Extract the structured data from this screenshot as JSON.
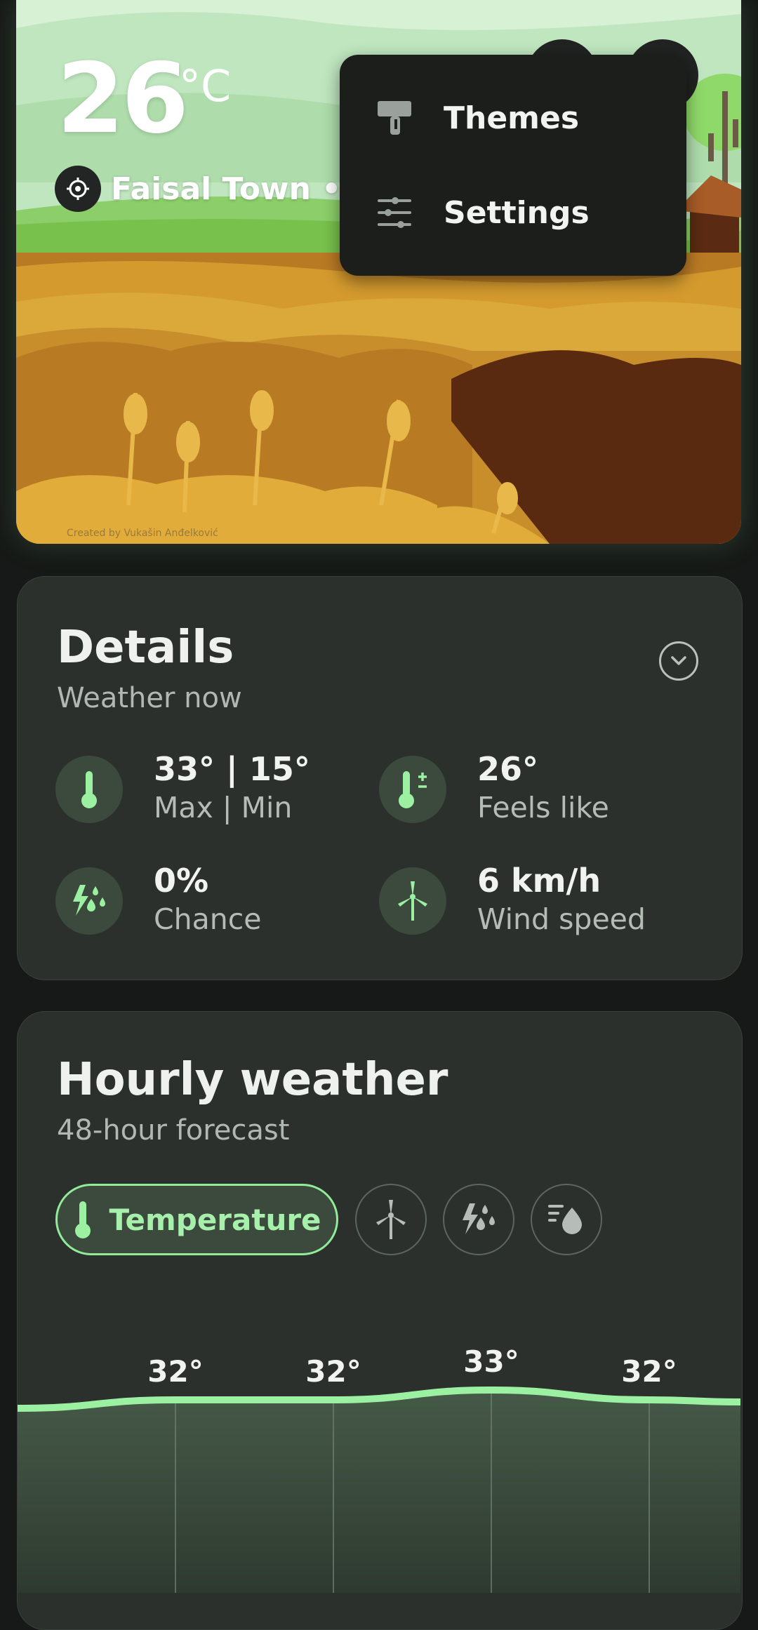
{
  "hero": {
    "temperature": "26",
    "unit": "°C",
    "location": "Faisal Town • C",
    "credit": "Created by Vukašin Anđelković"
  },
  "menu": {
    "items": [
      {
        "label": "Themes",
        "icon": "paint-roller-icon"
      },
      {
        "label": "Settings",
        "icon": "sliders-icon"
      }
    ]
  },
  "details": {
    "title": "Details",
    "subtitle": "Weather now",
    "items": [
      {
        "value": "33° | 15°",
        "label": "Max | Min",
        "icon": "thermometer-icon"
      },
      {
        "value": "26°",
        "label": "Feels like",
        "icon": "thermometer-plus-minus-icon"
      },
      {
        "value": "0%",
        "label": "Chance",
        "icon": "storm-rain-icon"
      },
      {
        "value": "6 km/h",
        "label": "Wind speed",
        "icon": "wind-turbine-icon"
      }
    ]
  },
  "hourly": {
    "title": "Hourly weather",
    "subtitle": "48-hour forecast",
    "chips": [
      {
        "label": "Temperature",
        "icon": "thermometer-icon",
        "active": true
      },
      {
        "label": "",
        "icon": "wind-turbine-icon",
        "active": false
      },
      {
        "label": "",
        "icon": "storm-rain-icon",
        "active": false
      },
      {
        "label": "",
        "icon": "humidity-drop-icon",
        "active": false
      }
    ]
  },
  "chart_data": {
    "type": "area",
    "title": "",
    "xlabel": "",
    "ylabel": "",
    "series": [
      {
        "values": [
          32,
          32,
          33,
          32
        ],
        "labels": [
          "32°",
          "32°",
          "33°",
          "32°"
        ]
      }
    ],
    "colors": {
      "line": "#9cf0a2",
      "fill": "#465a48"
    }
  },
  "colors": {
    "background": "#161917",
    "card": "#2b302c",
    "accent": "#90ec98",
    "icon_bg": "#3b4a3d"
  }
}
